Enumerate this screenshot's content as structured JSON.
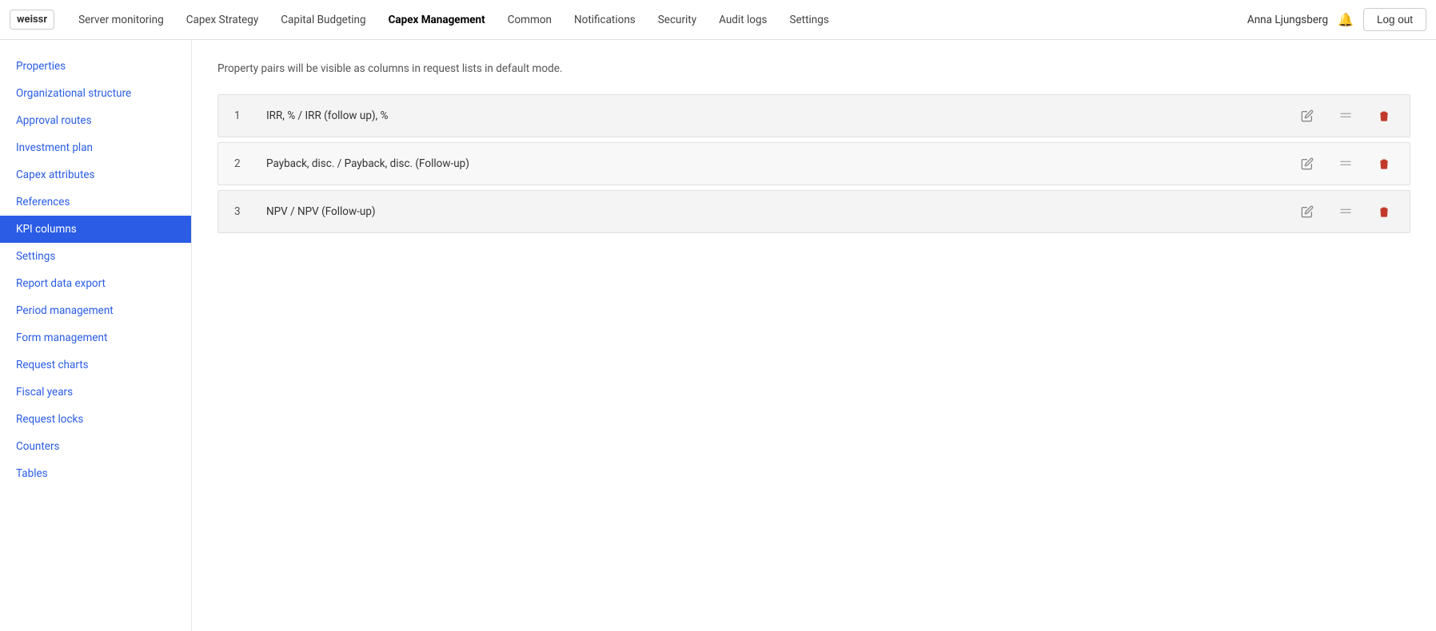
{
  "app": {
    "logo": "weissr"
  },
  "nav": {
    "links": [
      {
        "label": "Server monitoring",
        "active": false
      },
      {
        "label": "Capex Strategy",
        "active": false
      },
      {
        "label": "Capital Budgeting",
        "active": false
      },
      {
        "label": "Capex Management",
        "active": true
      },
      {
        "label": "Common",
        "active": false
      },
      {
        "label": "Notifications",
        "active": false
      },
      {
        "label": "Security",
        "active": false
      },
      {
        "label": "Audit logs",
        "active": false
      },
      {
        "label": "Settings",
        "active": false
      }
    ],
    "user": "Anna Ljungsberg",
    "logout_label": "Log out"
  },
  "sidebar": {
    "items": [
      {
        "label": "Properties",
        "active": false
      },
      {
        "label": "Organizational structure",
        "active": false
      },
      {
        "label": "Approval routes",
        "active": false
      },
      {
        "label": "Investment plan",
        "active": false
      },
      {
        "label": "Capex attributes",
        "active": false
      },
      {
        "label": "References",
        "active": false
      },
      {
        "label": "KPI columns",
        "active": true
      },
      {
        "label": "Settings",
        "active": false
      },
      {
        "label": "Report data export",
        "active": false
      },
      {
        "label": "Period management",
        "active": false
      },
      {
        "label": "Form management",
        "active": false
      },
      {
        "label": "Request charts",
        "active": false
      },
      {
        "label": "Fiscal years",
        "active": false
      },
      {
        "label": "Request locks",
        "active": false
      },
      {
        "label": "Counters",
        "active": false
      },
      {
        "label": "Tables",
        "active": false
      }
    ]
  },
  "main": {
    "subtitle": "Property pairs will be visible as columns in request lists in default mode.",
    "rows": [
      {
        "num": "1",
        "label": "IRR, % / IRR (follow up), %"
      },
      {
        "num": "2",
        "label": "Payback, disc. / Payback, disc. (Follow-up)"
      },
      {
        "num": "3",
        "label": "NPV / NPV (Follow-up)"
      }
    ]
  }
}
